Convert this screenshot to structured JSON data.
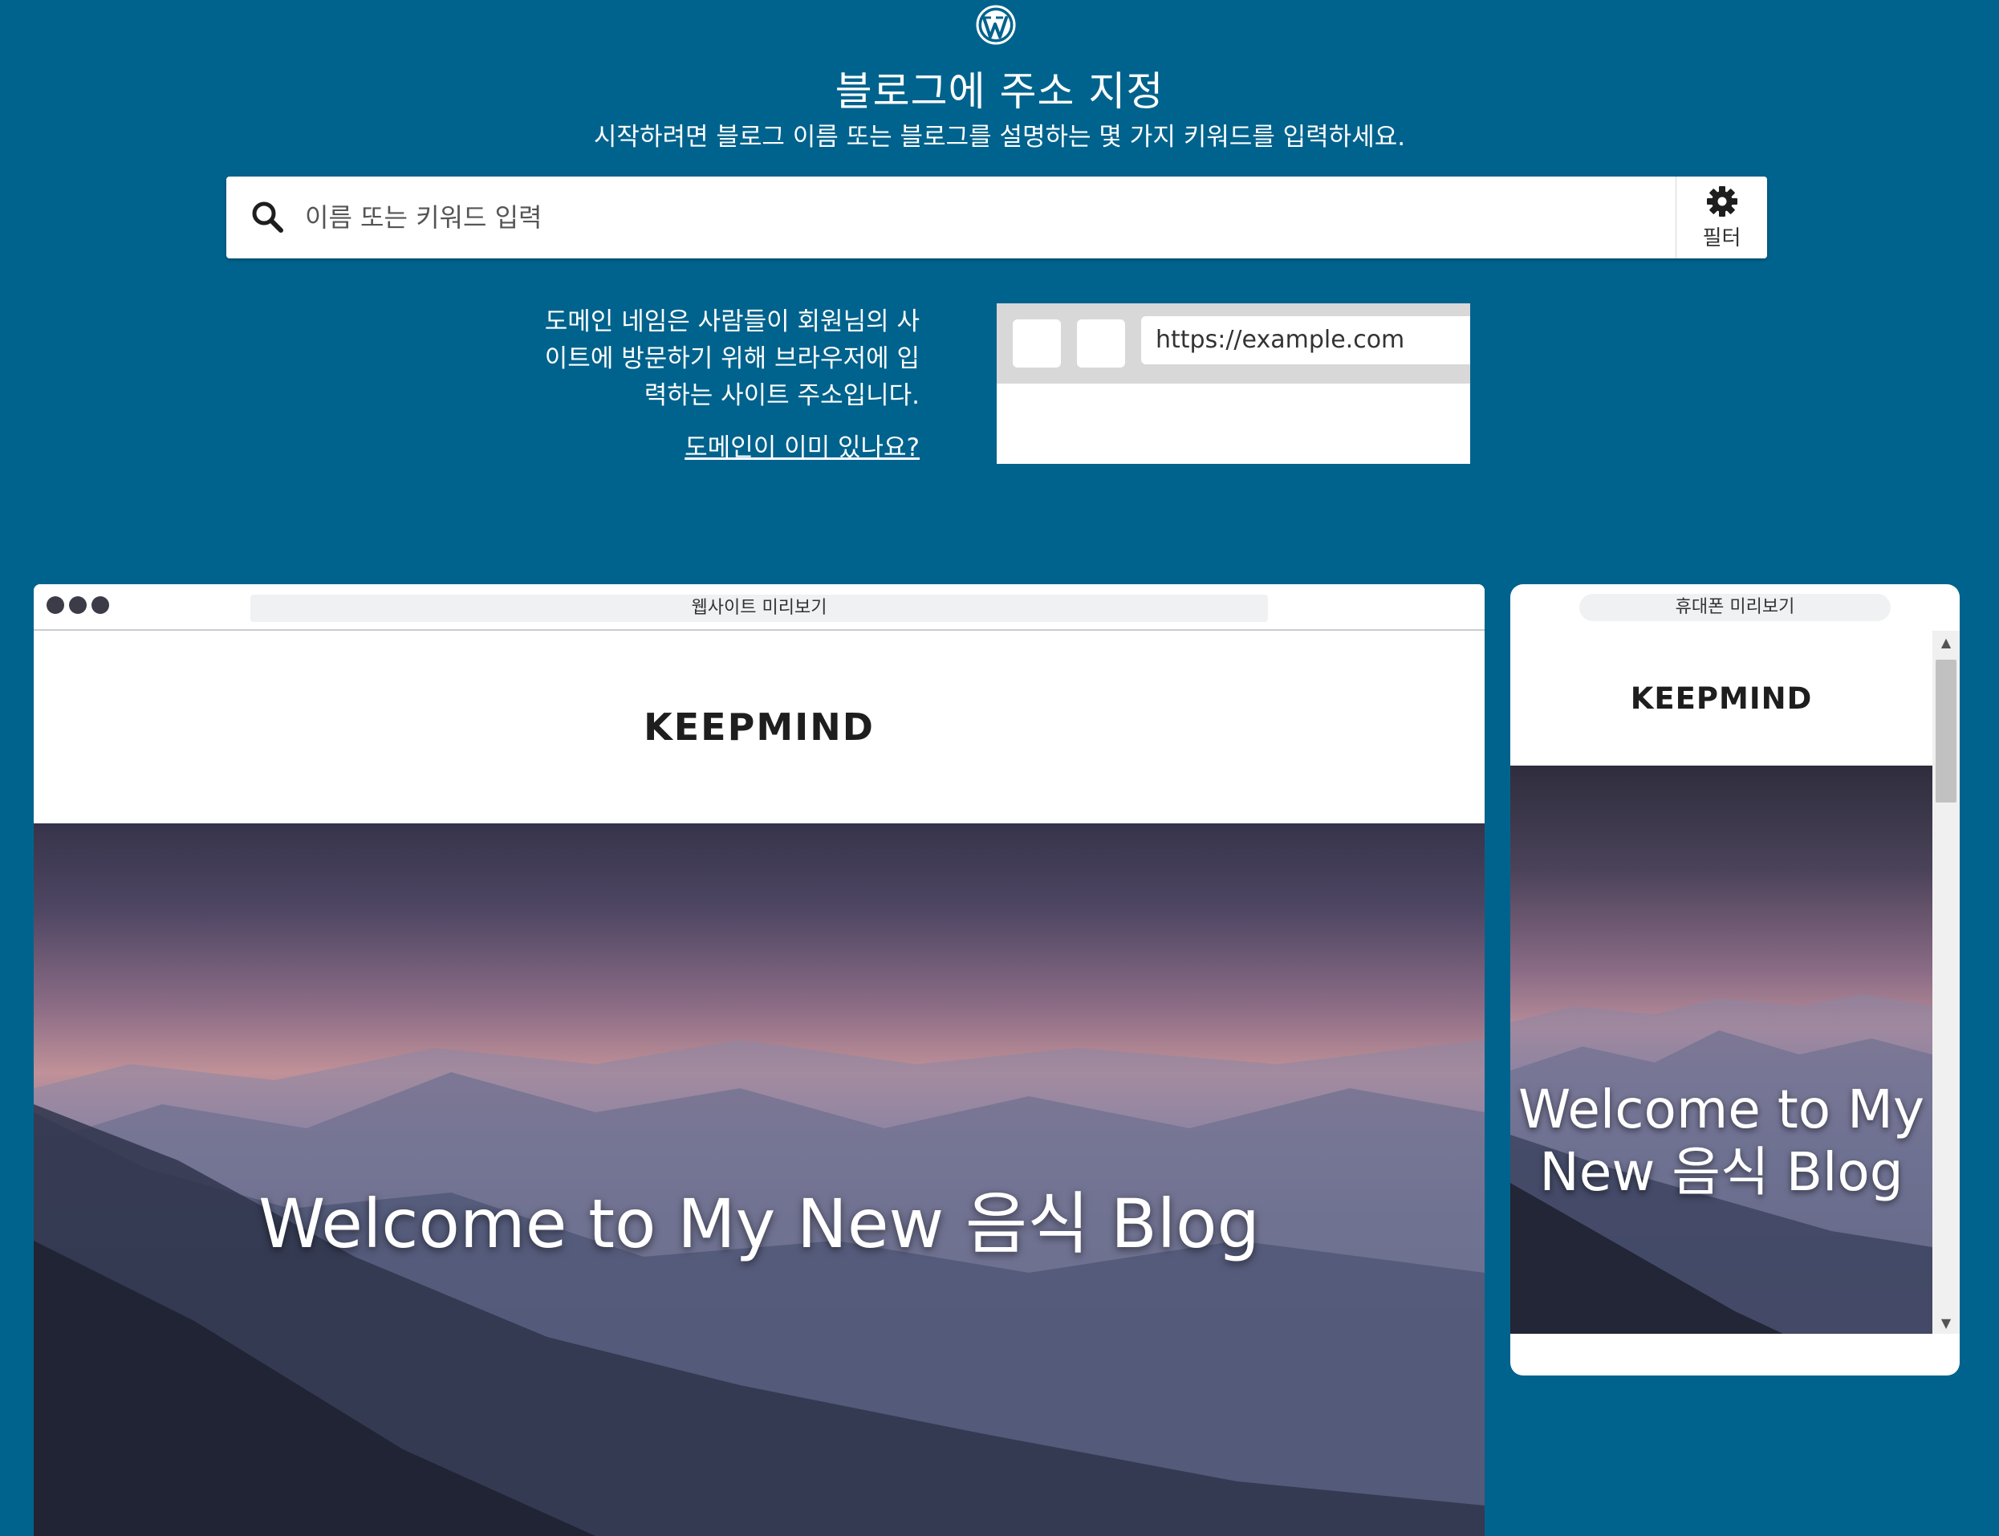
{
  "header": {
    "logo_icon": "wordpress-logo-icon",
    "title": "블로그에 주소 지정",
    "subtitle": "시작하려면 블로그 이름 또는 블로그를 설명하는 몇 가지 키워드를 입력하세요."
  },
  "search": {
    "icon": "search-icon",
    "placeholder": "이름 또는 키워드 입력",
    "value": "",
    "filter_icon": "gear-icon",
    "filter_label": "필터"
  },
  "domain_info": {
    "line1": "도메인 네임은 사람들이 회원님의 사",
    "line2": "이트에 방문하기 위해 브라우저에 입",
    "line3": "력하는 사이트 주소입니다.",
    "link": "도메인이 이미 있나요?",
    "example_url": "https://example.com"
  },
  "site_preview": {
    "toolbar_label": "웹사이트 미리보기",
    "site_name": "KEEPMIND",
    "hero_title": "Welcome to My New 음식 Blog"
  },
  "phone_preview": {
    "toolbar_label": "휴대폰 미리보기",
    "site_name": "KEEPMIND",
    "hero_title_line1": "Welcome to My",
    "hero_title_line2": "New 음식 Blog"
  },
  "colors": {
    "background": "#00638d",
    "text": "#ffffff"
  }
}
